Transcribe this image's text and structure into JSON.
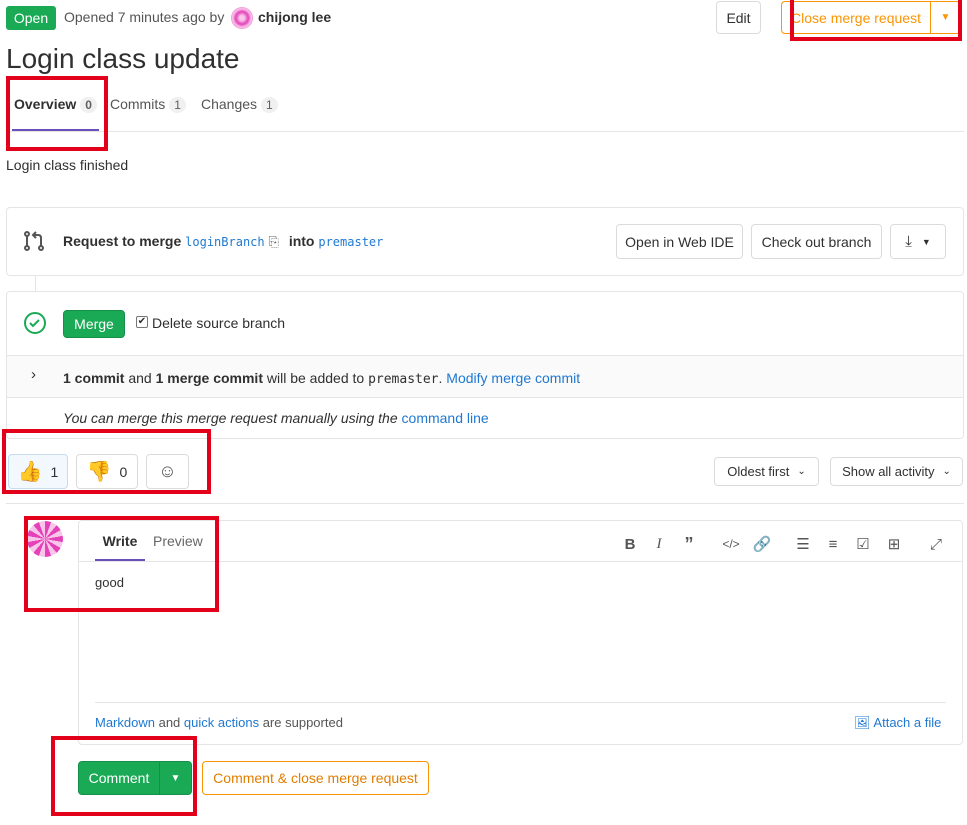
{
  "header": {
    "status": "Open",
    "opened_text": "Opened 7 minutes ago by",
    "author": "chijong lee",
    "edit_label": "Edit",
    "close_label": "Close merge request"
  },
  "title": "Login class update",
  "tabs": [
    {
      "label": "Overview",
      "count": "0"
    },
    {
      "label": "Commits",
      "count": "1"
    },
    {
      "label": "Changes",
      "count": "1"
    }
  ],
  "description": "Login class finished",
  "merge_info": {
    "prefix": "Request to merge",
    "source": "loginBranch",
    "into": "into",
    "target": "premaster",
    "web_ide_label": "Open in Web IDE",
    "checkout_label": "Check out branch"
  },
  "merge_widget": {
    "merge_label": "Merge",
    "delete_label": "Delete source branch",
    "commit_count": "1 commit",
    "and": "and",
    "merge_commit": "1 merge commit",
    "added_to": "will be added to",
    "target": "premaster",
    "period": ".",
    "modify_link": "Modify merge commit",
    "manual_text": "You can merge this merge request manually using the",
    "command_line": "command line"
  },
  "reactions": {
    "thumbs_up_count": "1",
    "thumbs_down_count": "0"
  },
  "activity": {
    "sort_label": "Oldest first",
    "filter_label": "Show all activity"
  },
  "comment_box": {
    "write_tab": "Write",
    "preview_tab": "Preview",
    "text": "good",
    "markdown_link": "Markdown",
    "and": "and",
    "quick_actions": "quick actions",
    "supported": "are supported",
    "attach_label": "Attach a file",
    "comment_label": "Comment",
    "comment_close_label": "Comment & close merge request"
  },
  "colors": {
    "green": "#1aaa55",
    "orange": "#fc9403",
    "link": "#1f78d1",
    "annotation_red": "#e2001a",
    "avatar_pink": "#e542b9"
  }
}
